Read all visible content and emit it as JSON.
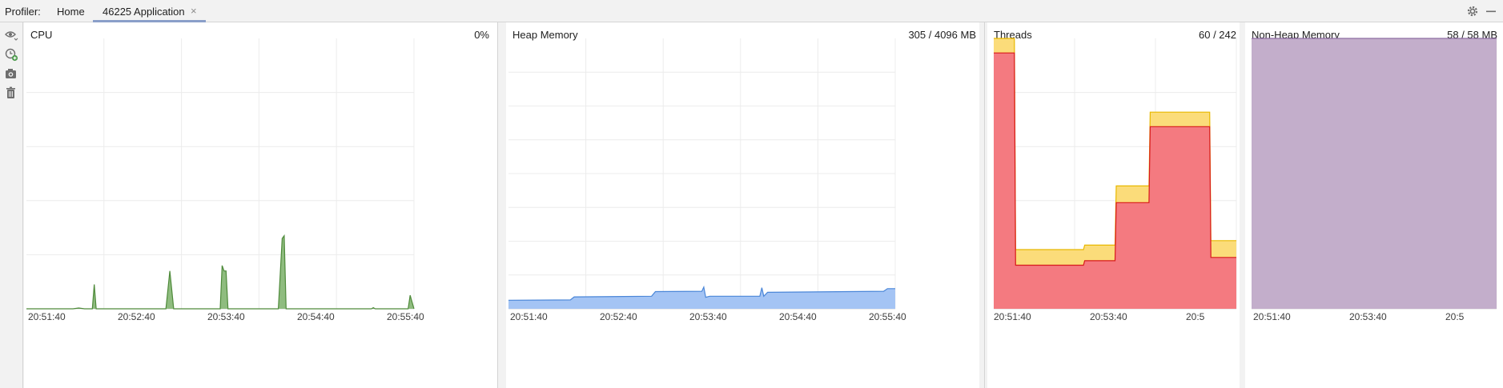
{
  "toolbar": {
    "profiler_label": "Profiler:",
    "tabs": [
      {
        "label": "Home"
      },
      {
        "label": "46225 Application"
      }
    ],
    "close_glyph": "×",
    "settings_icon": "gear-icon",
    "minimize_icon": "minimize-icon"
  },
  "sidebar": {
    "icons": [
      "eye-icon",
      "add-session-icon",
      "capture-snapshot-icon",
      "trash-icon"
    ]
  },
  "panels": {
    "cpu": {
      "title": "CPU",
      "value": "0%"
    },
    "heap": {
      "title": "Heap Memory",
      "value": "305 / 4096 MB"
    },
    "threads": {
      "title": "Threads",
      "value": "60 / 242"
    },
    "nonheap": {
      "title": "Non-Heap Memory",
      "value": "58 / 58 MB"
    }
  },
  "colors": {
    "cpu_line": "#4e8a3a",
    "cpu_fill": "#8fbc7f",
    "heap_line": "#4a86d8",
    "heap_fill": "#a4c4f4",
    "threads_total_fill": "#fbdc7a",
    "threads_total_line": "#e8b800",
    "threads_active_fill": "#f47a80",
    "threads_active_line": "#d81a1a",
    "nonheap_fill": "#c3aecb",
    "nonheap_line": "#8e6fa2"
  },
  "chart_data": [
    {
      "type": "area",
      "title": "CPU",
      "x_ticks": [
        "20:51:40",
        "20:52:40",
        "20:53:40",
        "20:54:40",
        "20:55:40"
      ],
      "ylim": [
        0,
        100
      ],
      "grid": true,
      "series": [
        {
          "values": [
            [
              0,
              0
            ],
            [
              0.12,
              0
            ],
            [
              0.135,
              0.3
            ],
            [
              0.15,
              0
            ],
            [
              0.17,
              0
            ],
            [
              0.175,
              9
            ],
            [
              0.18,
              0
            ],
            [
              0.36,
              0
            ],
            [
              0.37,
              14
            ],
            [
              0.38,
              0
            ],
            [
              0.5,
              0
            ],
            [
              0.505,
              16
            ],
            [
              0.51,
              14
            ],
            [
              0.515,
              14
            ],
            [
              0.52,
              0
            ],
            [
              0.65,
              0
            ],
            [
              0.66,
              26
            ],
            [
              0.665,
              27
            ],
            [
              0.67,
              0
            ],
            [
              0.89,
              0
            ],
            [
              0.895,
              0.4
            ],
            [
              0.9,
              0
            ],
            [
              0.985,
              0
            ],
            [
              0.99,
              5
            ],
            [
              1.0,
              0
            ]
          ]
        }
      ]
    },
    {
      "type": "area",
      "title": "Heap Memory",
      "x_ticks": [
        "20:51:40",
        "20:52:40",
        "20:53:40",
        "20:54:40",
        "20:55:40"
      ],
      "ylim": [
        0,
        4096
      ],
      "grid": true,
      "series": [
        {
          "values": [
            [
              0,
              130
            ],
            [
              0.16,
              135
            ],
            [
              0.17,
              180
            ],
            [
              0.37,
              190
            ],
            [
              0.38,
              260
            ],
            [
              0.5,
              265
            ],
            [
              0.505,
              330
            ],
            [
              0.51,
              175
            ],
            [
              0.52,
              190
            ],
            [
              0.65,
              190
            ],
            [
              0.655,
              320
            ],
            [
              0.66,
              190
            ],
            [
              0.67,
              250
            ],
            [
              0.97,
              265
            ],
            [
              0.98,
              305
            ],
            [
              1.0,
              305
            ]
          ]
        }
      ]
    },
    {
      "type": "area",
      "title": "Threads",
      "x_ticks": [
        "20:51:40",
        "20:53:40",
        "20:5"
      ],
      "ylim": [
        0,
        242
      ],
      "grid": true,
      "series": [
        {
          "values": [
            [
              0,
              242
            ],
            [
              0.085,
              242
            ],
            [
              0.09,
              53
            ],
            [
              0.37,
              53
            ],
            [
              0.375,
              57
            ],
            [
              0.5,
              57
            ],
            [
              0.505,
              110
            ],
            [
              0.64,
              110
            ],
            [
              0.645,
              176
            ],
            [
              0.89,
              176
            ],
            [
              0.895,
              61
            ],
            [
              1.0,
              61
            ]
          ]
        },
        {
          "values": [
            [
              0,
              229
            ],
            [
              0.085,
              229
            ],
            [
              0.09,
              39
            ],
            [
              0.37,
              39
            ],
            [
              0.375,
              43
            ],
            [
              0.5,
              43
            ],
            [
              0.505,
              95
            ],
            [
              0.64,
              95
            ],
            [
              0.645,
              163
            ],
            [
              0.89,
              163
            ],
            [
              0.895,
              46
            ],
            [
              1.0,
              46
            ]
          ]
        }
      ]
    },
    {
      "type": "area",
      "title": "Non-Heap Memory",
      "x_ticks": [
        "20:51:40",
        "20:53:40",
        "20:5"
      ],
      "ylim": [
        0,
        58
      ],
      "grid": true,
      "series": [
        {
          "values": [
            [
              0,
              58
            ],
            [
              1.0,
              58
            ]
          ]
        }
      ]
    }
  ]
}
